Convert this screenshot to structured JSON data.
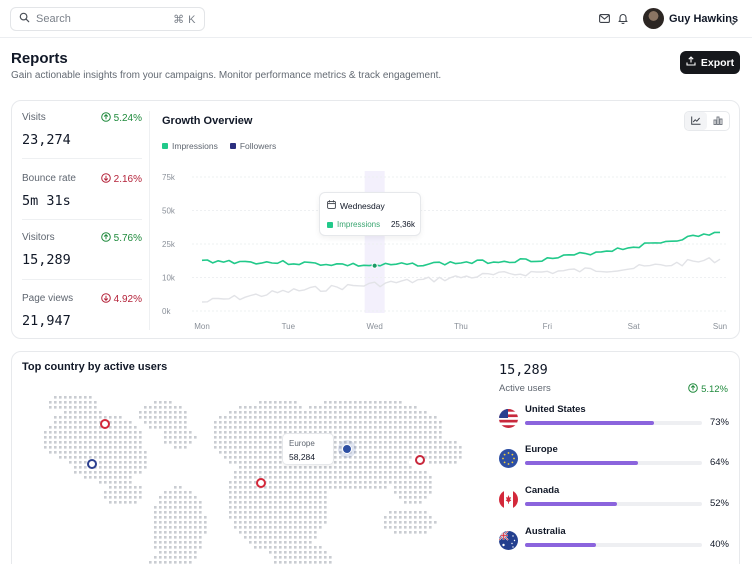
{
  "topbar": {
    "search_placeholder": "Search",
    "search_shortcut": "⌘ K",
    "icons": [
      "search-icon",
      "mail-icon",
      "bell-icon",
      "chevron-down-icon"
    ],
    "user_name": "Guy Hawkins"
  },
  "header": {
    "title": "Reports",
    "subtitle": "Gain actionable insights from your campaigns. Monitor performance metrics & track engagement.",
    "export_label": "Export"
  },
  "stats": [
    {
      "label": "Visits",
      "value": "23,274",
      "delta": "5.24%",
      "trend": "up"
    },
    {
      "label": "Bounce rate",
      "value": "5m 31s",
      "delta": "2.16%",
      "trend": "down"
    },
    {
      "label": "Visitors",
      "value": "15,289",
      "delta": "5.76%",
      "trend": "up"
    },
    {
      "label": "Page views",
      "value": "21,947",
      "delta": "4.92%",
      "trend": "down"
    }
  ],
  "colors": {
    "impressions": "#22c98a",
    "followers": "#2b2f7e",
    "followers_line": "#e2e3e7",
    "accent_bar": "#8b64dd",
    "up": "#1f8a3c",
    "down": "#b4233a"
  },
  "chart_data": {
    "type": "line",
    "title": "Growth Overview",
    "legend_position": "top-left",
    "x": [
      "Mon",
      "Tue",
      "Wed",
      "Thu",
      "Fri",
      "Sat",
      "Sun"
    ],
    "ylim": [
      0,
      75000
    ],
    "y_ticks": [
      "75k",
      "50k",
      "25k",
      "10k",
      "0k"
    ],
    "grid": true,
    "series": [
      {
        "name": "Impressions",
        "values": [
          28000,
          27000,
          25360,
          27000,
          29000,
          36000,
          44000
        ]
      },
      {
        "name": "Followers",
        "values": [
          5000,
          11000,
          15000,
          19000,
          22000,
          24000,
          29000
        ]
      }
    ],
    "tooltip": {
      "day": "Wednesday",
      "series": "Impressions",
      "value": "25,36k"
    }
  },
  "map": {
    "title": "Top country by active users",
    "tooltip_region": "Europe",
    "tooltip_value": "58,284"
  },
  "active_users": {
    "value": "15,289",
    "label": "Active users",
    "delta": "5.12%",
    "countries": [
      {
        "name": "United States",
        "pct_label": "73%",
        "pct": 0.73
      },
      {
        "name": "Europe",
        "pct_label": "64%",
        "pct": 0.64
      },
      {
        "name": "Canada",
        "pct_label": "52%",
        "pct": 0.52
      },
      {
        "name": "Australia",
        "pct_label": "40%",
        "pct": 0.4
      }
    ]
  }
}
